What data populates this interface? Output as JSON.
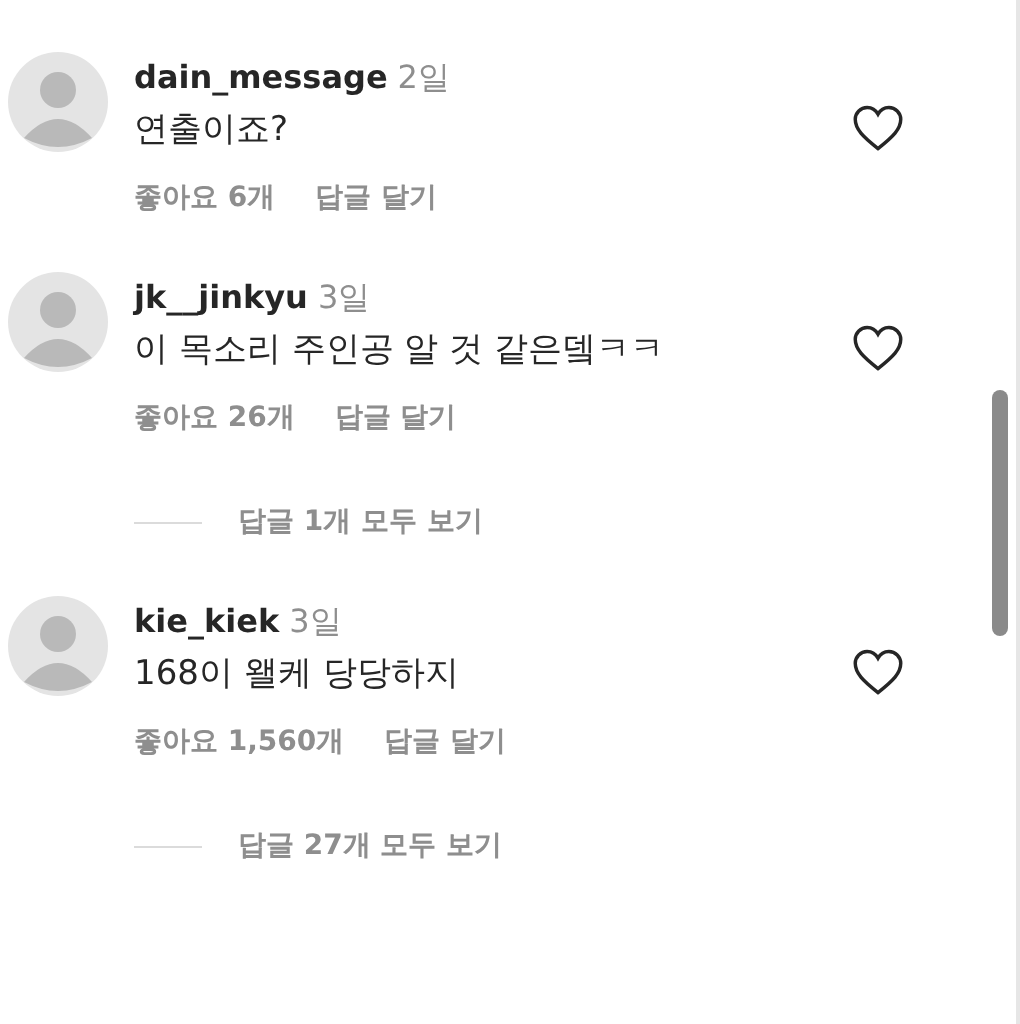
{
  "comments": [
    {
      "username": "dain_message",
      "time": "2일",
      "text": "연출이죠?",
      "likes": "좋아요 6개",
      "reply": "답글 달기",
      "liked": false
    },
    {
      "username": "jk__jinkyu",
      "time": "3일",
      "text": "이 목소리 주인공 알 것 같은뎈ㅋㅋ",
      "likes": "좋아요 26개",
      "reply": "답글 달기",
      "liked": false,
      "view_replies": "답글 1개 모두 보기"
    },
    {
      "username": "kie_kiek",
      "time": "3일",
      "text": "168이 왤케 당당하지",
      "likes": "좋아요 1,560개",
      "reply": "답글 달기",
      "liked": false,
      "view_replies": "답글 27개 모두 보기"
    }
  ]
}
